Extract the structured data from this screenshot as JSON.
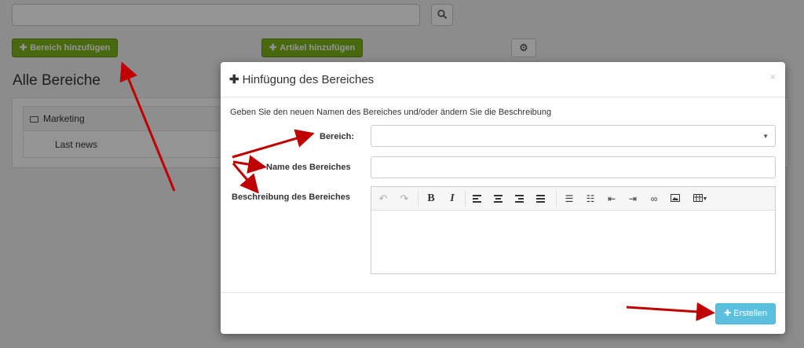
{
  "background": {
    "add_area_button": "Bereich hinzufügen",
    "add_article_button": "Artikel hinzufügen",
    "page_title": "Alle Bereiche",
    "areas": [
      {
        "label": "Marketing"
      },
      {
        "label": "Last news"
      }
    ]
  },
  "modal": {
    "title": "Hinfügung des Bereiches",
    "close": "×",
    "intro": "Geben Sie den neuen Namen des Bereiches und/oder ändern Sie die Beschreibung",
    "fields": {
      "area_label": "Bereich:",
      "area_value": "",
      "name_label": "Name des Bereiches",
      "name_value": "",
      "description_label": "Beschreibung des Bereiches"
    },
    "create_button": "Erstellen"
  },
  "icons": [
    "search-icon",
    "gear-icon",
    "folder-icon",
    "plus-icon",
    "close-icon",
    "undo-icon",
    "redo-icon",
    "bold-icon",
    "italic-icon",
    "align-left-icon",
    "align-center-icon",
    "align-right-icon",
    "justify-icon",
    "bullet-list-icon",
    "numbered-list-icon",
    "outdent-icon",
    "indent-icon",
    "link-icon",
    "image-icon",
    "table-icon"
  ],
  "colors": {
    "green_button": "#7cb518",
    "info_button": "#5bc0de",
    "annotation_arrow": "#c00000"
  }
}
